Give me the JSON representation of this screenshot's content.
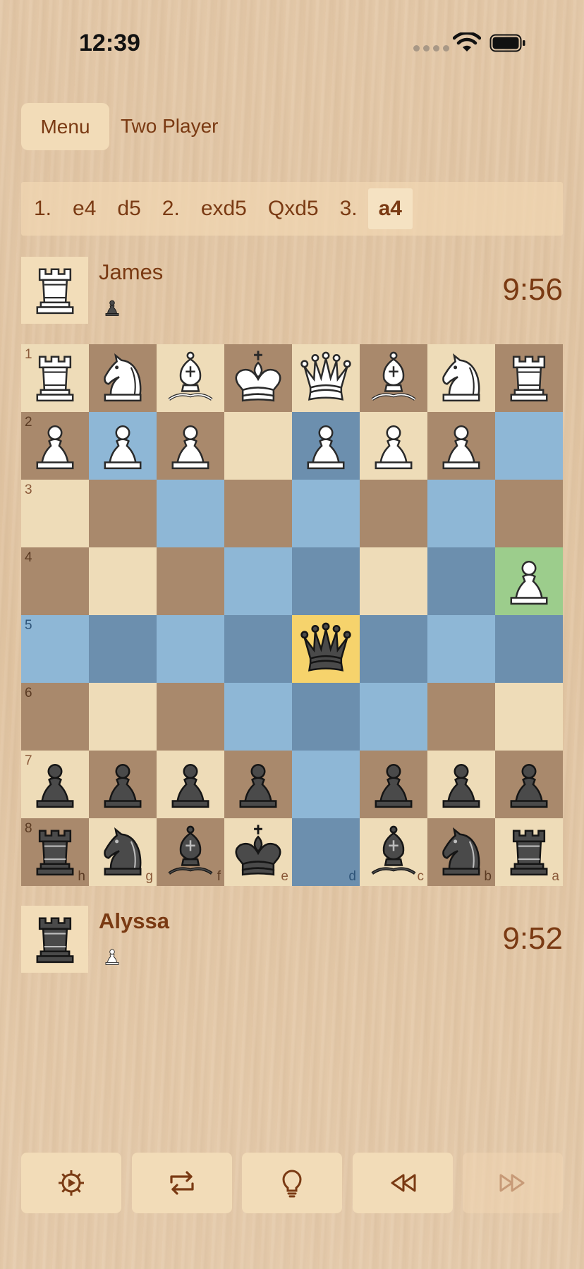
{
  "status_bar": {
    "time": "12:39"
  },
  "top_bar": {
    "menu_label": "Menu",
    "mode_title": "Two Player"
  },
  "move_list": [
    {
      "text": "1.",
      "current": false
    },
    {
      "text": "e4",
      "current": false
    },
    {
      "text": "d5",
      "current": false
    },
    {
      "text": "2.",
      "current": false
    },
    {
      "text": "exd5",
      "current": false
    },
    {
      "text": "Qxd5",
      "current": false
    },
    {
      "text": "3.",
      "current": false
    },
    {
      "text": "a4",
      "current": true
    }
  ],
  "players": {
    "top": {
      "name": "James",
      "clock": "9:56",
      "avatar_piece": "white-rook",
      "captured": [
        "black-pawn"
      ]
    },
    "bottom": {
      "name": "Alyssa",
      "clock": "9:52",
      "avatar_piece": "black-rook",
      "captured": [
        "white-pawn"
      ]
    }
  },
  "board": {
    "orientation": "flipped",
    "rank_labels": [
      "1",
      "2",
      "3",
      "4",
      "5",
      "6",
      "7",
      "8"
    ],
    "file_labels": [
      "h",
      "g",
      "f",
      "e",
      "d",
      "c",
      "b",
      "a"
    ],
    "colors": {
      "light": "#eedcb8",
      "dark": "#a9896c",
      "move_light": "#8eb7d6",
      "move_dark": "#6c8fae",
      "selected": "#f6d36c",
      "last_move": "#9ccd8c",
      "label_on_light": "#8b5a3a",
      "label_on_dark": "#5a3a22",
      "label_on_blue": "#2e5478"
    },
    "rows": [
      [
        "wR",
        "wN",
        "wB",
        "wK",
        "wQ",
        "wB",
        "wN",
        "wR"
      ],
      [
        "wP",
        "wP",
        "wP",
        "",
        "wP",
        "wP",
        "wP",
        ""
      ],
      [
        "",
        "",
        "",
        "",
        "",
        "",
        "",
        ""
      ],
      [
        "",
        "",
        "",
        "",
        "",
        "",
        "",
        "wP"
      ],
      [
        "",
        "",
        "",
        "",
        "bQ",
        "",
        "",
        ""
      ],
      [
        "",
        "",
        "",
        "",
        "",
        "",
        "",
        ""
      ],
      [
        "bP",
        "bP",
        "bP",
        "bP",
        "",
        "bP",
        "bP",
        "bP"
      ],
      [
        "bR",
        "bN",
        "bB",
        "bK",
        "",
        "bB",
        "bN",
        "bR"
      ]
    ],
    "highlights": [
      ".......o",
      ".m..m..m",
      "..m.m.m.",
      "...mm.ml",
      "mmmmsmmm",
      "...mmm..",
      "....m...",
      "....m..."
    ]
  },
  "toolbar": [
    {
      "name": "settings-button",
      "icon": "gear-icon",
      "enabled": true
    },
    {
      "name": "flip-board-button",
      "icon": "flip-arrows-icon",
      "enabled": true
    },
    {
      "name": "hint-button",
      "icon": "lightbulb-icon",
      "enabled": true
    },
    {
      "name": "undo-move-button",
      "icon": "rewind-icon",
      "enabled": true
    },
    {
      "name": "redo-move-button",
      "icon": "fast-forward-icon",
      "enabled": false
    }
  ]
}
